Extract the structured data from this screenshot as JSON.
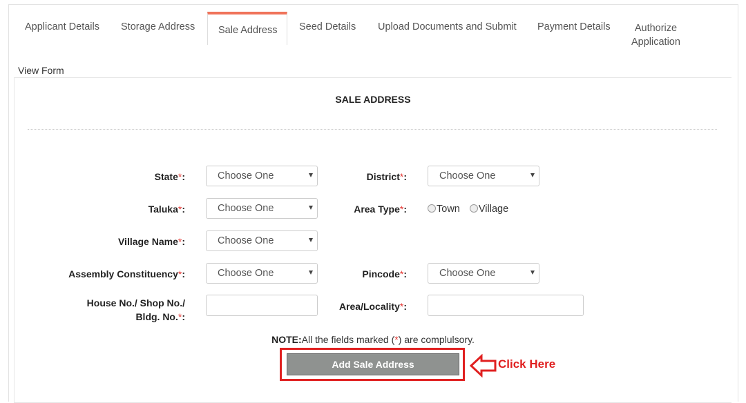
{
  "tabs": [
    "Applicant Details",
    "Storage Address",
    "Sale Address",
    "Seed Details",
    "Upload Documents and Submit",
    "Payment Details",
    "Authorize",
    "Application"
  ],
  "view_form": "View Form",
  "section_title": "SALE ADDRESS",
  "required_mark": "*",
  "colon": ":",
  "labels": {
    "state": "State",
    "district": "District",
    "taluka": "Taluka",
    "area_type": "Area Type",
    "village_name": "Village Name",
    "assembly": "Assembly Constituency",
    "pincode": "Pincode",
    "house_line1": "House No./ Shop No./",
    "house_line2": "Bldg. No.",
    "area_locality": "Area/Locality"
  },
  "select_placeholder": "Choose One",
  "radio": {
    "town": "Town",
    "village": "Village"
  },
  "note": {
    "prefix": "NOTE:",
    "text1": "All the fields marked (",
    "mark": "*",
    "text2": ") are complulsory."
  },
  "button_label": "Add Sale Address",
  "annotation": "Click Here",
  "colors": {
    "accent_tab": "#f0735a",
    "required": "#e53935",
    "highlight": "#e02020",
    "button": "#8f9290"
  }
}
